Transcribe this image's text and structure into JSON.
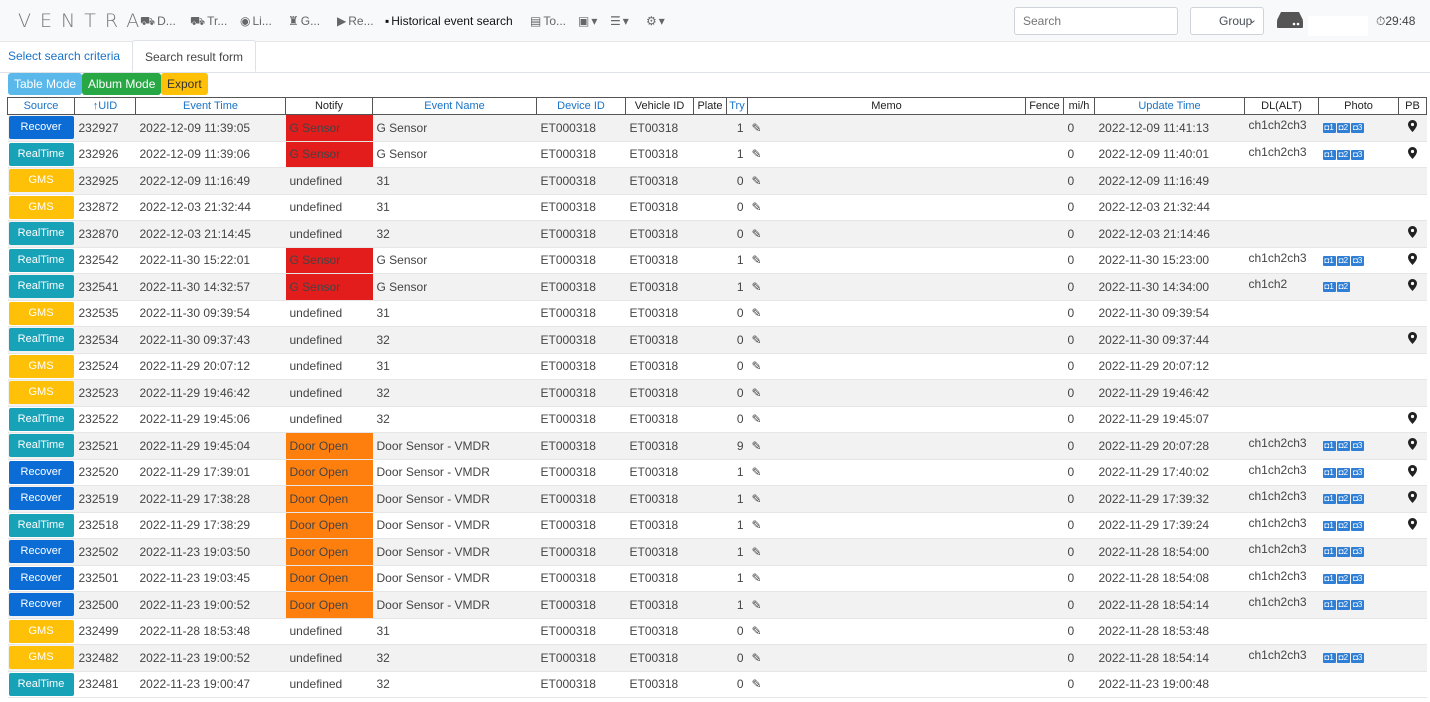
{
  "navbar": {
    "brand": "VENTRA",
    "items": [
      {
        "icon": "dashboard-icon",
        "glyph": "⛟",
        "label": "D..."
      },
      {
        "icon": "tracking-icon",
        "glyph": "⛟",
        "label": "Tr..."
      },
      {
        "icon": "eye-icon",
        "glyph": "◉",
        "label": "Li..."
      },
      {
        "icon": "map-icon",
        "glyph": "♜",
        "label": "G..."
      },
      {
        "icon": "play-icon",
        "glyph": "▶",
        "label": "Re..."
      },
      {
        "icon": "save-icon",
        "glyph": "▪",
        "label": "Historical event search"
      },
      {
        "icon": "tools-icon",
        "glyph": "▤",
        "label": "To..."
      },
      {
        "icon": "storage-icon",
        "glyph": "▣",
        "label": "▾"
      },
      {
        "icon": "list-icon",
        "glyph": "☰",
        "label": "▾"
      },
      {
        "icon": "settings-icon",
        "glyph": "⚙",
        "label": "▾"
      }
    ],
    "search_placeholder": "Search",
    "group_label": "Group",
    "clock": "29:48"
  },
  "tabs": [
    "Select search criteria",
    "Search result form"
  ],
  "buttons": {
    "table_mode": "Table Mode",
    "album_mode": "Album Mode",
    "export": "Export"
  },
  "columns": [
    "Source",
    "↑UID",
    "Event Time",
    "Notify",
    "Event Name",
    "Device ID",
    "Vehicle ID",
    "Plate",
    "Try",
    "Memo",
    "Fence",
    "mi/h",
    "Update Time",
    "DL(ALT)",
    "Photo",
    "PB"
  ],
  "source_colors": {
    "Recover": "#0b6cd6",
    "RealTime": "#17a2b8",
    "GMS": "#ffc107"
  },
  "rows": [
    {
      "source": "Recover",
      "uid": "232927",
      "time": "2022-12-09 11:39:05",
      "notify": "G Sensor",
      "nc": "red",
      "event": "G Sensor",
      "device": "ET000318",
      "vehicle": "ET00318",
      "try": "1",
      "mph": "0",
      "update": "2022-12-09 11:41:13",
      "dl": "ch1ch2ch3",
      "photos": 3,
      "pb": true
    },
    {
      "source": "RealTime",
      "uid": "232926",
      "time": "2022-12-09 11:39:06",
      "notify": "G Sensor",
      "nc": "red",
      "event": "G Sensor",
      "device": "ET000318",
      "vehicle": "ET00318",
      "try": "1",
      "mph": "0",
      "update": "2022-12-09 11:40:01",
      "dl": "ch1ch2ch3",
      "photos": 3,
      "pb": true
    },
    {
      "source": "GMS",
      "uid": "232925",
      "time": "2022-12-09 11:16:49",
      "notify": "undefined",
      "nc": "",
      "event": "31",
      "device": "ET000318",
      "vehicle": "ET00318",
      "try": "0",
      "mph": "0",
      "update": "2022-12-09 11:16:49",
      "dl": "",
      "photos": 0,
      "pb": false
    },
    {
      "source": "GMS",
      "uid": "232872",
      "time": "2022-12-03 21:32:44",
      "notify": "undefined",
      "nc": "",
      "event": "31",
      "device": "ET000318",
      "vehicle": "ET00318",
      "try": "0",
      "mph": "0",
      "update": "2022-12-03 21:32:44",
      "dl": "",
      "photos": 0,
      "pb": false
    },
    {
      "source": "RealTime",
      "uid": "232870",
      "time": "2022-12-03 21:14:45",
      "notify": "undefined",
      "nc": "",
      "event": "32",
      "device": "ET000318",
      "vehicle": "ET00318",
      "try": "0",
      "mph": "0",
      "update": "2022-12-03 21:14:46",
      "dl": "",
      "photos": 0,
      "pb": true
    },
    {
      "source": "RealTime",
      "uid": "232542",
      "time": "2022-11-30 15:22:01",
      "notify": "G Sensor",
      "nc": "red",
      "event": "G Sensor",
      "device": "ET000318",
      "vehicle": "ET00318",
      "try": "1",
      "mph": "0",
      "update": "2022-11-30 15:23:00",
      "dl": "ch1ch2ch3",
      "photos": 3,
      "pb": true
    },
    {
      "source": "RealTime",
      "uid": "232541",
      "time": "2022-11-30 14:32:57",
      "notify": "G Sensor",
      "nc": "red",
      "event": "G Sensor",
      "device": "ET000318",
      "vehicle": "ET00318",
      "try": "1",
      "mph": "0",
      "update": "2022-11-30 14:34:00",
      "dl": "ch1ch2",
      "photos": 2,
      "pb": true
    },
    {
      "source": "GMS",
      "uid": "232535",
      "time": "2022-11-30 09:39:54",
      "notify": "undefined",
      "nc": "",
      "event": "31",
      "device": "ET000318",
      "vehicle": "ET00318",
      "try": "0",
      "mph": "0",
      "update": "2022-11-30 09:39:54",
      "dl": "",
      "photos": 0,
      "pb": false
    },
    {
      "source": "RealTime",
      "uid": "232534",
      "time": "2022-11-30 09:37:43",
      "notify": "undefined",
      "nc": "",
      "event": "32",
      "device": "ET000318",
      "vehicle": "ET00318",
      "try": "0",
      "mph": "0",
      "update": "2022-11-30 09:37:44",
      "dl": "",
      "photos": 0,
      "pb": true
    },
    {
      "source": "GMS",
      "uid": "232524",
      "time": "2022-11-29 20:07:12",
      "notify": "undefined",
      "nc": "",
      "event": "31",
      "device": "ET000318",
      "vehicle": "ET00318",
      "try": "0",
      "mph": "0",
      "update": "2022-11-29 20:07:12",
      "dl": "",
      "photos": 0,
      "pb": false
    },
    {
      "source": "GMS",
      "uid": "232523",
      "time": "2022-11-29 19:46:42",
      "notify": "undefined",
      "nc": "",
      "event": "32",
      "device": "ET000318",
      "vehicle": "ET00318",
      "try": "0",
      "mph": "0",
      "update": "2022-11-29 19:46:42",
      "dl": "",
      "photos": 0,
      "pb": false
    },
    {
      "source": "RealTime",
      "uid": "232522",
      "time": "2022-11-29 19:45:06",
      "notify": "undefined",
      "nc": "",
      "event": "32",
      "device": "ET000318",
      "vehicle": "ET00318",
      "try": "0",
      "mph": "0",
      "update": "2022-11-29 19:45:07",
      "dl": "",
      "photos": 0,
      "pb": true
    },
    {
      "source": "RealTime",
      "uid": "232521",
      "time": "2022-11-29 19:45:04",
      "notify": "Door Open",
      "nc": "orange",
      "event": "Door Sensor - VMDR",
      "device": "ET000318",
      "vehicle": "ET00318",
      "try": "9",
      "mph": "0",
      "update": "2022-11-29 20:07:28",
      "dl": "ch1ch2ch3",
      "photos": 3,
      "pb": true
    },
    {
      "source": "Recover",
      "uid": "232520",
      "time": "2022-11-29 17:39:01",
      "notify": "Door Open",
      "nc": "orange",
      "event": "Door Sensor - VMDR",
      "device": "ET000318",
      "vehicle": "ET00318",
      "try": "1",
      "mph": "0",
      "update": "2022-11-29 17:40:02",
      "dl": "ch1ch2ch3",
      "photos": 3,
      "pb": true
    },
    {
      "source": "Recover",
      "uid": "232519",
      "time": "2022-11-29 17:38:28",
      "notify": "Door Open",
      "nc": "orange",
      "event": "Door Sensor - VMDR",
      "device": "ET000318",
      "vehicle": "ET00318",
      "try": "1",
      "mph": "0",
      "update": "2022-11-29 17:39:32",
      "dl": "ch1ch2ch3",
      "photos": 3,
      "pb": true
    },
    {
      "source": "RealTime",
      "uid": "232518",
      "time": "2022-11-29 17:38:29",
      "notify": "Door Open",
      "nc": "orange",
      "event": "Door Sensor - VMDR",
      "device": "ET000318",
      "vehicle": "ET00318",
      "try": "1",
      "mph": "0",
      "update": "2022-11-29 17:39:24",
      "dl": "ch1ch2ch3",
      "photos": 3,
      "pb": true
    },
    {
      "source": "Recover",
      "uid": "232502",
      "time": "2022-11-23 19:03:50",
      "notify": "Door Open",
      "nc": "orange",
      "event": "Door Sensor - VMDR",
      "device": "ET000318",
      "vehicle": "ET00318",
      "try": "1",
      "mph": "0",
      "update": "2022-11-28 18:54:00",
      "dl": "ch1ch2ch3",
      "photos": 3,
      "pb": false
    },
    {
      "source": "Recover",
      "uid": "232501",
      "time": "2022-11-23 19:03:45",
      "notify": "Door Open",
      "nc": "orange",
      "event": "Door Sensor - VMDR",
      "device": "ET000318",
      "vehicle": "ET00318",
      "try": "1",
      "mph": "0",
      "update": "2022-11-28 18:54:08",
      "dl": "ch1ch2ch3",
      "photos": 3,
      "pb": false
    },
    {
      "source": "Recover",
      "uid": "232500",
      "time": "2022-11-23 19:00:52",
      "notify": "Door Open",
      "nc": "orange",
      "event": "Door Sensor - VMDR",
      "device": "ET000318",
      "vehicle": "ET00318",
      "try": "1",
      "mph": "0",
      "update": "2022-11-28 18:54:14",
      "dl": "ch1ch2ch3",
      "photos": 3,
      "pb": false
    },
    {
      "source": "GMS",
      "uid": "232499",
      "time": "2022-11-28 18:53:48",
      "notify": "undefined",
      "nc": "",
      "event": "31",
      "device": "ET000318",
      "vehicle": "ET00318",
      "try": "0",
      "mph": "0",
      "update": "2022-11-28 18:53:48",
      "dl": "",
      "photos": 0,
      "pb": false
    },
    {
      "source": "GMS",
      "uid": "232482",
      "time": "2022-11-23 19:00:52",
      "notify": "undefined",
      "nc": "",
      "event": "32",
      "device": "ET000318",
      "vehicle": "ET00318",
      "try": "0",
      "mph": "0",
      "update": "2022-11-28 18:54:14",
      "dl": "ch1ch2ch3",
      "photos": 3,
      "pb": false
    },
    {
      "source": "RealTime",
      "uid": "232481",
      "time": "2022-11-23 19:00:47",
      "notify": "undefined",
      "nc": "",
      "event": "32",
      "device": "ET000318",
      "vehicle": "ET00318",
      "try": "0",
      "mph": "0",
      "update": "2022-11-23 19:00:48",
      "dl": "",
      "photos": 0,
      "pb": false
    }
  ]
}
